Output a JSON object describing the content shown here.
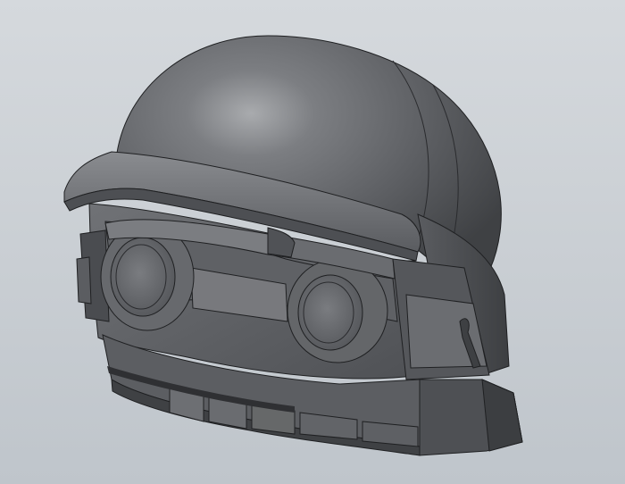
{
  "scene": {
    "subject": "helmet-3d-model",
    "background_color": "#c9ced3",
    "model_fill": "#6e7074",
    "model_highlight": "#a7a9ad",
    "model_shadow": "#3e4043",
    "edge_color": "#1f2022"
  }
}
